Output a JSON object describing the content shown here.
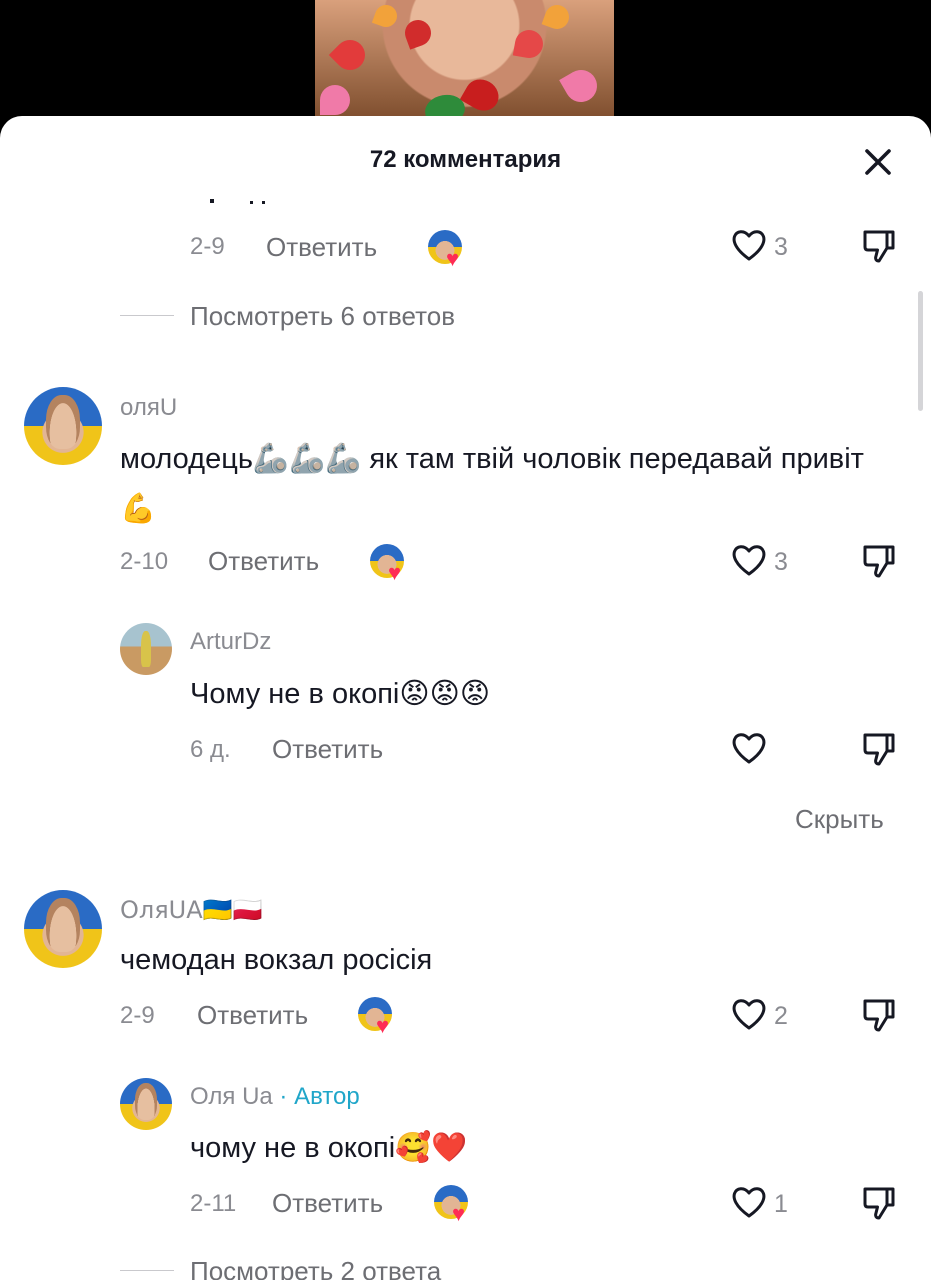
{
  "header": {
    "title": "72 комментария"
  },
  "prev_comment": {
    "date": "2-9",
    "reply_label": "Ответить",
    "likes": "3"
  },
  "view_replies_1": "Посмотреть 6 ответов",
  "comments": [
    {
      "username": "оляU",
      "text": "молодець🦾🦾🦾 як там твій чоловік передавай привіт💪",
      "date": "2-10",
      "reply_label": "Ответить",
      "likes": "3"
    },
    {
      "username": "ArturDz",
      "text": "Чому не в окопі😡😡😡",
      "date": "6 д.",
      "reply_label": "Ответить",
      "likes": ""
    },
    {
      "username": "ОляUA🇺🇦🇵🇱",
      "text": "чемодан вокзал росісія",
      "date": "2-9",
      "reply_label": "Ответить",
      "likes": "2"
    },
    {
      "username": "Оля Ua",
      "author_tag": " · Автор",
      "text": "чому не в окопі🥰❤️",
      "date": "2-11",
      "reply_label": "Ответить",
      "likes": "1"
    }
  ],
  "hide_label": "Скрыть",
  "view_replies_2": "Посмотреть 2 ответа",
  "colors": {
    "accent_author": "#20a6c9",
    "like_heart": "#fe2c55",
    "text_primary": "#161823",
    "text_secondary": "#8a8b91"
  },
  "icons": [
    "close-icon",
    "heart-outline-icon",
    "dislike-icon",
    "liked-by-creator-icon"
  ]
}
